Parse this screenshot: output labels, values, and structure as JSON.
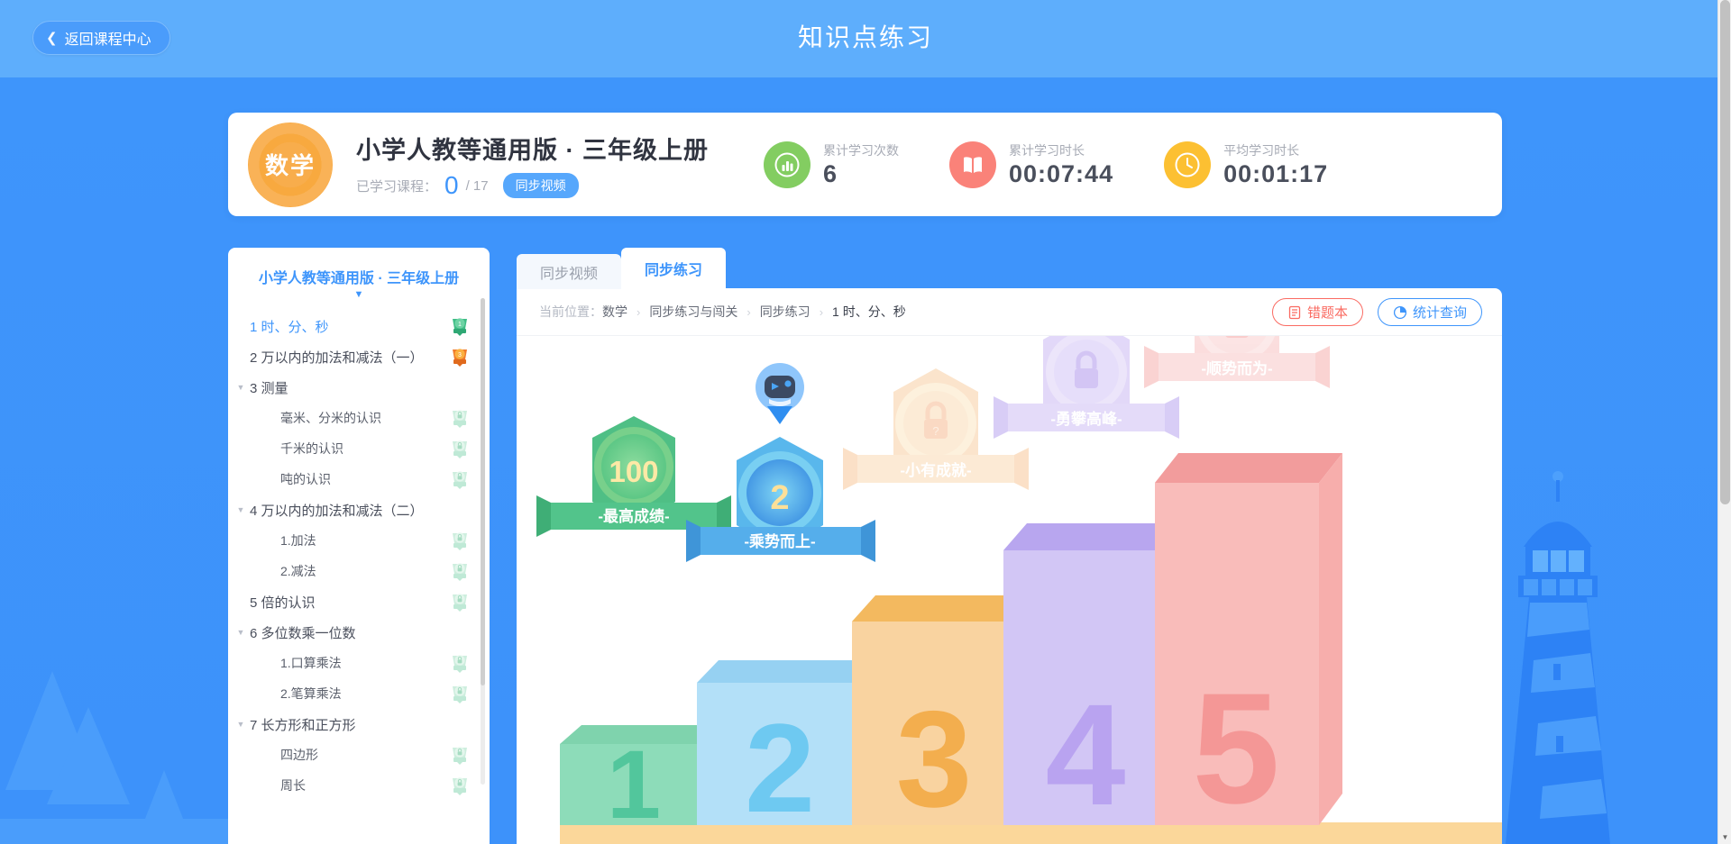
{
  "topbar": {
    "back_label": "返回课程中心",
    "back_chevron": "chevron-left-icon",
    "title": "知识点练习"
  },
  "info_card": {
    "subject_badge": "数学",
    "course_name": "小学人教等通用版 · 三年级上册",
    "progress_label": "已学习课程：",
    "progress_value": "0",
    "progress_total": "/ 17",
    "video_tag": "同步视频",
    "stats": [
      {
        "label": "累计学习次数",
        "value": "6",
        "icon": "bar-chart-icon",
        "color": "#83cd61"
      },
      {
        "label": "累计学习时长",
        "value": "00:07:44",
        "icon": "book-icon",
        "color": "#fa8279"
      },
      {
        "label": "平均学习时长",
        "value": "00:01:17",
        "icon": "clock-icon",
        "color": "#fcc032"
      }
    ]
  },
  "sidebar": {
    "title": "小学人教等通用版 · 三年级上册",
    "caret_icon": "chevron-down-icon",
    "items": [
      {
        "label": "1 时、分、秒",
        "level": 1,
        "arrow": false,
        "active": true,
        "medal": "medal-green-1"
      },
      {
        "label": "2 万以内的加法和减法（一）",
        "level": 1,
        "arrow": false,
        "active": false,
        "medal": "medal-orange-3"
      },
      {
        "label": "3 测量",
        "level": 1,
        "arrow": true,
        "active": false,
        "medal": ""
      },
      {
        "label": "毫米、分米的认识",
        "level": 2,
        "arrow": false,
        "active": false,
        "medal": "medal-locked"
      },
      {
        "label": "千米的认识",
        "level": 2,
        "arrow": false,
        "active": false,
        "medal": "medal-locked"
      },
      {
        "label": "吨的认识",
        "level": 2,
        "arrow": false,
        "active": false,
        "medal": "medal-locked"
      },
      {
        "label": "4 万以内的加法和减法（二）",
        "level": 1,
        "arrow": true,
        "active": false,
        "medal": ""
      },
      {
        "label": "1.加法",
        "level": 2,
        "arrow": false,
        "active": false,
        "medal": "medal-locked"
      },
      {
        "label": "2.减法",
        "level": 2,
        "arrow": false,
        "active": false,
        "medal": "medal-locked"
      },
      {
        "label": "5 倍的认识",
        "level": 1,
        "arrow": false,
        "active": false,
        "medal": "medal-locked"
      },
      {
        "label": "6 多位数乘一位数",
        "level": 1,
        "arrow": true,
        "active": false,
        "medal": ""
      },
      {
        "label": "1.口算乘法",
        "level": 2,
        "arrow": false,
        "active": false,
        "medal": "medal-locked"
      },
      {
        "label": "2.笔算乘法",
        "level": 2,
        "arrow": false,
        "active": false,
        "medal": "medal-locked"
      },
      {
        "label": "7 长方形和正方形",
        "level": 1,
        "arrow": true,
        "active": false,
        "medal": ""
      },
      {
        "label": "四边形",
        "level": 2,
        "arrow": false,
        "active": false,
        "medal": "medal-locked"
      },
      {
        "label": "周长",
        "level": 2,
        "arrow": false,
        "active": false,
        "medal": "medal-locked"
      }
    ]
  },
  "tabs": [
    {
      "label": "同步视频",
      "active": false
    },
    {
      "label": "同步练习",
      "active": true
    }
  ],
  "breadcrumb": {
    "prefix": "当前位置：",
    "segments": [
      "数学",
      "同步练习与闯关",
      "同步练习",
      "1 时、分、秒"
    ],
    "separator": "›"
  },
  "actions": [
    {
      "label": "错题本",
      "icon": "notebook-icon",
      "color": "#fa6b62"
    },
    {
      "label": "统计查询",
      "icon": "pie-chart-icon",
      "color": "#3e95fb"
    }
  ],
  "stage": {
    "robot_icon": "robot-avatar-icon",
    "podium": [
      {
        "number": "1",
        "color": "#8ddcb9",
        "top": "#7fd3ad",
        "face": "#95e0c0"
      },
      {
        "number": "2",
        "color": "#aadcf6",
        "top": "#96d1f2",
        "face": "#b3e0f8"
      },
      {
        "number": "3",
        "color": "#f8cf96",
        "top": "#f3b95f",
        "face": "#f9d3a0"
      },
      {
        "number": "4",
        "color": "#cbbdf3",
        "top": "#b8a6ef",
        "face": "#d2c6f5"
      },
      {
        "number": "5",
        "color": "#f8b3b1",
        "top": "#f29c9c",
        "face": "#f9bcba"
      }
    ],
    "badges": [
      {
        "title": "100",
        "ribbon": "-最高成绩-",
        "color": "#5bc48c",
        "locked": false
      },
      {
        "title": "2",
        "ribbon": "-乘势而上-",
        "color": "#4aa8e8",
        "locked": false
      },
      {
        "title": "",
        "ribbon": "-小有成就-",
        "color": "#f6c99a",
        "locked": true
      },
      {
        "title": "",
        "ribbon": "-勇攀高峰-",
        "color": "#c8b6f2",
        "locked": true
      },
      {
        "title": "",
        "ribbon": "-顺势而为-",
        "color": "#f8c0c0",
        "locked": true
      }
    ]
  },
  "colors": {
    "brand_blue": "#3e95fb",
    "header_blue": "#5eaefc",
    "accent_orange": "#f9a83c",
    "accent_red": "#fa6b62"
  }
}
